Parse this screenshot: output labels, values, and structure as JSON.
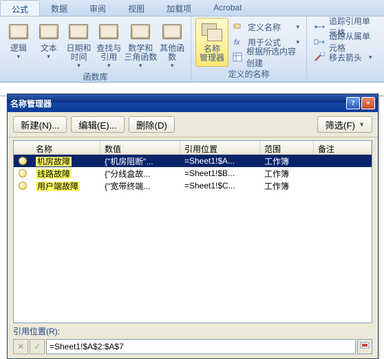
{
  "ribbon": {
    "tabs": [
      "公式",
      "数据",
      "审阅",
      "视图",
      "加载项",
      "Acrobat"
    ],
    "active_tab": 0,
    "fxlib": {
      "label": "函数库",
      "buttons": [
        {
          "label": "逻辑"
        },
        {
          "label": "文本"
        },
        {
          "label": "日期和\n时间"
        },
        {
          "label": "查找与\n引用"
        },
        {
          "label": "数学和\n三角函数"
        },
        {
          "label": "其他函数"
        }
      ]
    },
    "defnames": {
      "label": "定义的名称",
      "manager_label": "名称\n管理器",
      "items": [
        "定义名称",
        "用于公式",
        "根据所选内容创建"
      ]
    },
    "audit": {
      "items": [
        "追踪引用单元格",
        "追踪从属单元格",
        "移去箭头"
      ]
    }
  },
  "dialog": {
    "title": "名称管理器",
    "help": "?",
    "close": "×",
    "toolbar": {
      "new": "新建(N)...",
      "edit": "编辑(E)...",
      "delete": "删除(D)",
      "filter": "筛选(F)"
    },
    "columns": [
      "名称",
      "数值",
      "引用位置",
      "范围",
      "备注"
    ],
    "rows": [
      {
        "name": "机房故障",
        "value": "{\"机房阻断\"...",
        "ref": "=Sheet1!$A...",
        "scope": "工作簿",
        "note": ""
      },
      {
        "name": "线路故障",
        "value": "{\"分线盒故...",
        "ref": "=Sheet1!$B...",
        "scope": "工作簿",
        "note": ""
      },
      {
        "name": "用户端故障",
        "value": "{\"宽带终端...",
        "ref": "=Sheet1!$C...",
        "scope": "工作簿",
        "note": ""
      }
    ],
    "selected": 0,
    "ref_label": "引用位置(R):",
    "ref_value": "=Sheet1!$A$2:$A$7"
  }
}
